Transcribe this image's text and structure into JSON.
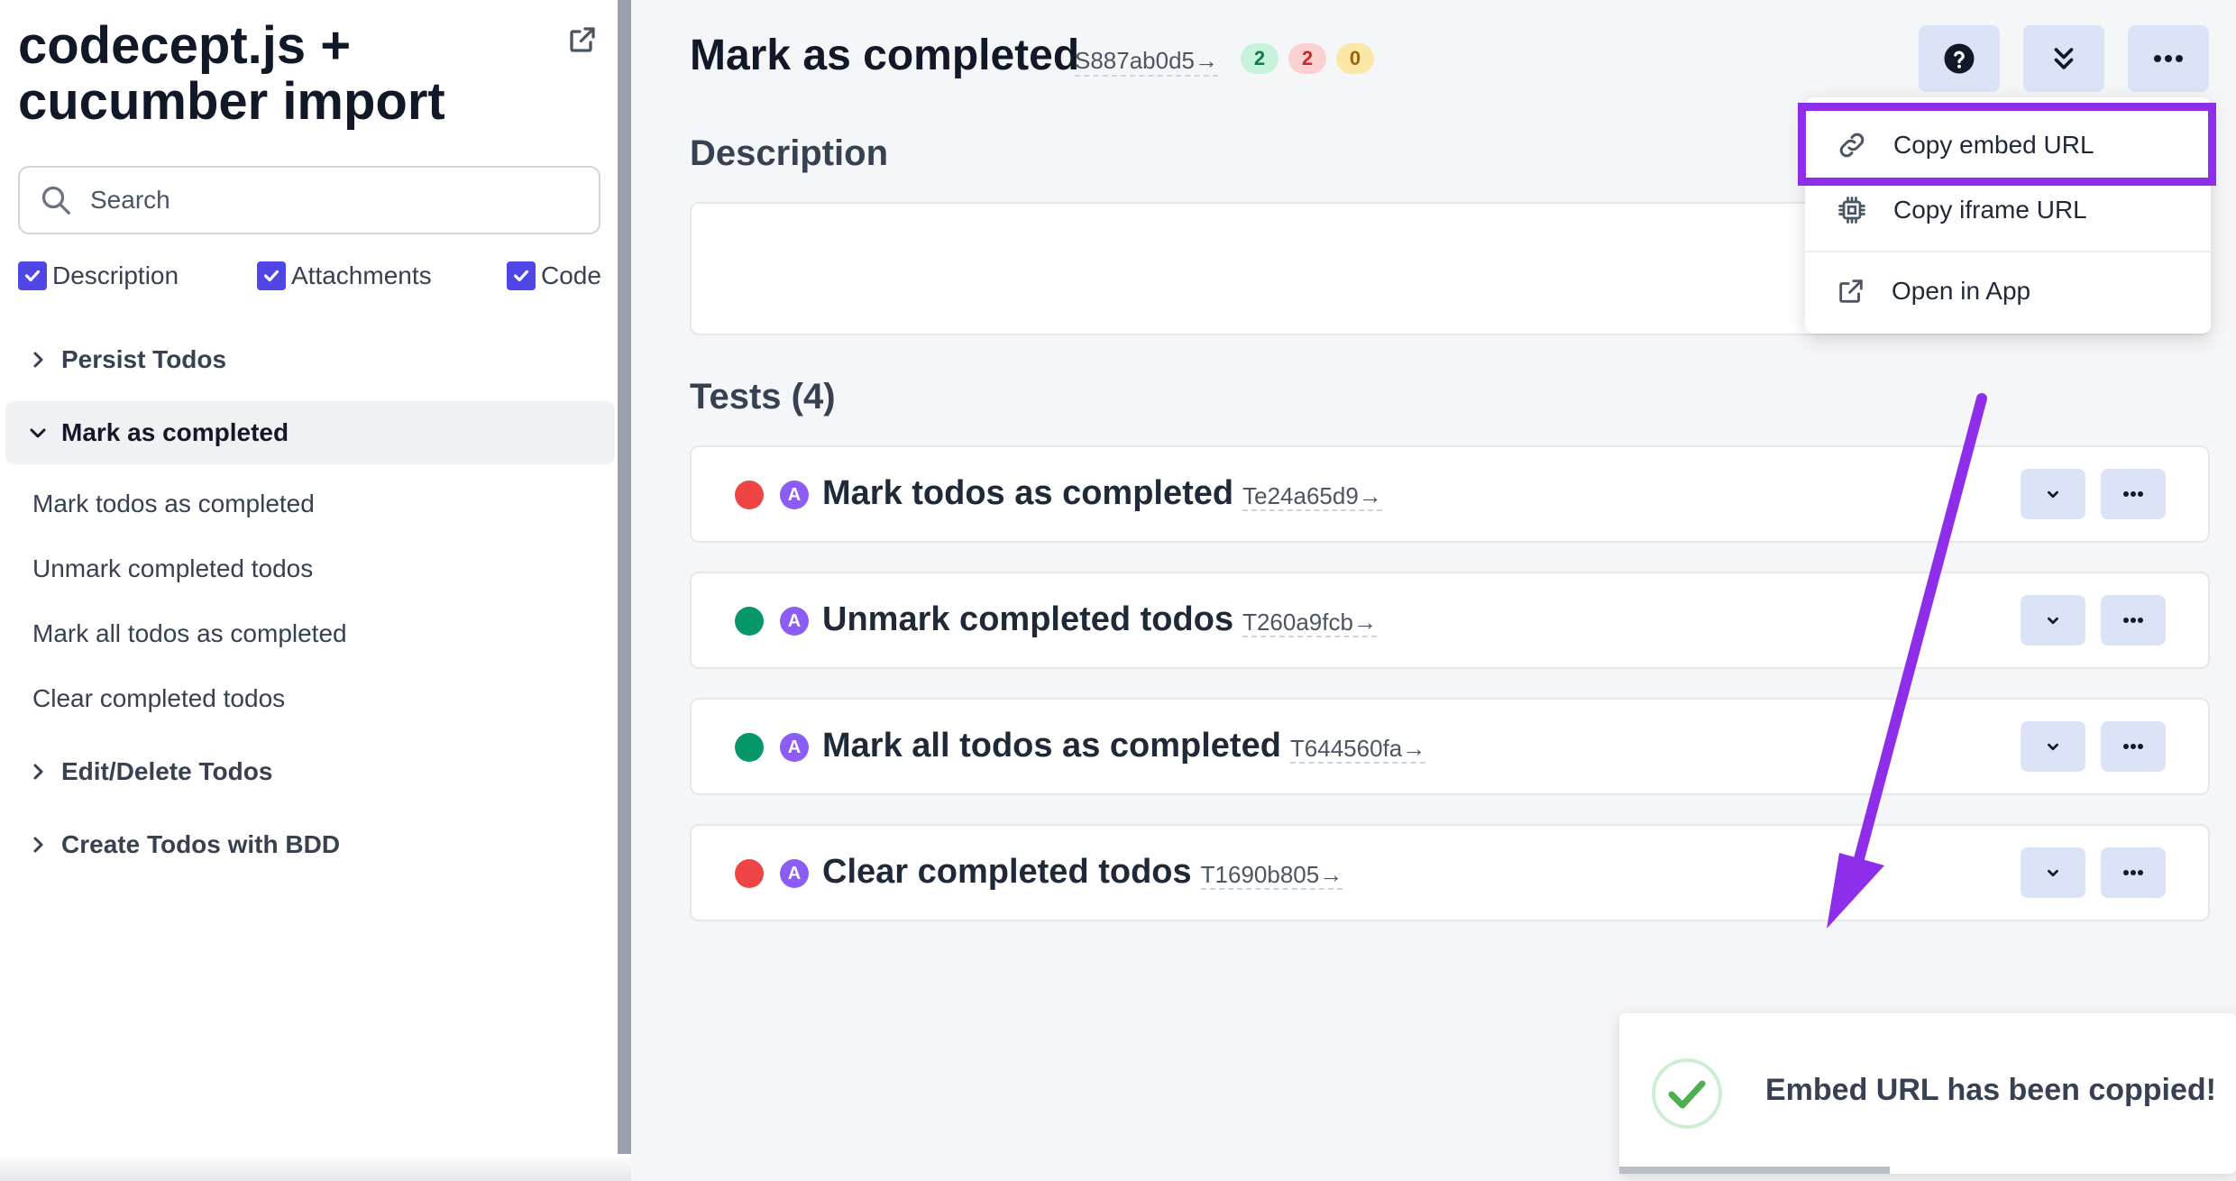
{
  "sidebar": {
    "title": "codecept.js + cucumber import",
    "search_placeholder": "Search",
    "filters": [
      {
        "label": "Description",
        "checked": true
      },
      {
        "label": "Attachments",
        "checked": true
      },
      {
        "label": "Code",
        "checked": true
      }
    ],
    "tree": {
      "persist": "Persist Todos",
      "mark": "Mark as completed",
      "mark_children": [
        "Mark todos as completed",
        "Unmark completed todos",
        "Mark all todos as completed",
        "Clear completed todos"
      ],
      "edit": "Edit/Delete Todos",
      "create": "Create Todos with BDD"
    }
  },
  "header": {
    "title": "Mark as completed",
    "suite_id": "S887ab0d5→",
    "badges": [
      {
        "value": "2",
        "bg": "#c7f3dc",
        "fg": "#0f7a4b"
      },
      {
        "value": "2",
        "bg": "#fbd0d0",
        "fg": "#c62828"
      },
      {
        "value": "0",
        "bg": "#fbe7a6",
        "fg": "#a16207"
      }
    ]
  },
  "description_title": "Description",
  "tests_title": "Tests (4)",
  "tests": [
    {
      "name": "Mark todos as completed",
      "id": "Te24a65d9→",
      "status": "failed",
      "type": "A"
    },
    {
      "name": "Unmark completed todos",
      "id": "T260a9fcb→",
      "status": "passed",
      "type": "A"
    },
    {
      "name": "Mark all todos as completed",
      "id": "T644560fa→",
      "status": "passed",
      "type": "A"
    },
    {
      "name": "Clear completed todos",
      "id": "T1690b805→",
      "status": "failed",
      "type": "A"
    }
  ],
  "colors": {
    "failed": "#ef4444",
    "passed": "#059669",
    "accent": "#4f46e5",
    "annotation": "#8f2eea"
  },
  "menu": {
    "copy_embed": "Copy embed URL",
    "copy_iframe": "Copy iframe URL",
    "open_app": "Open in App"
  },
  "toast": {
    "message": "Embed URL has been coppied!"
  }
}
